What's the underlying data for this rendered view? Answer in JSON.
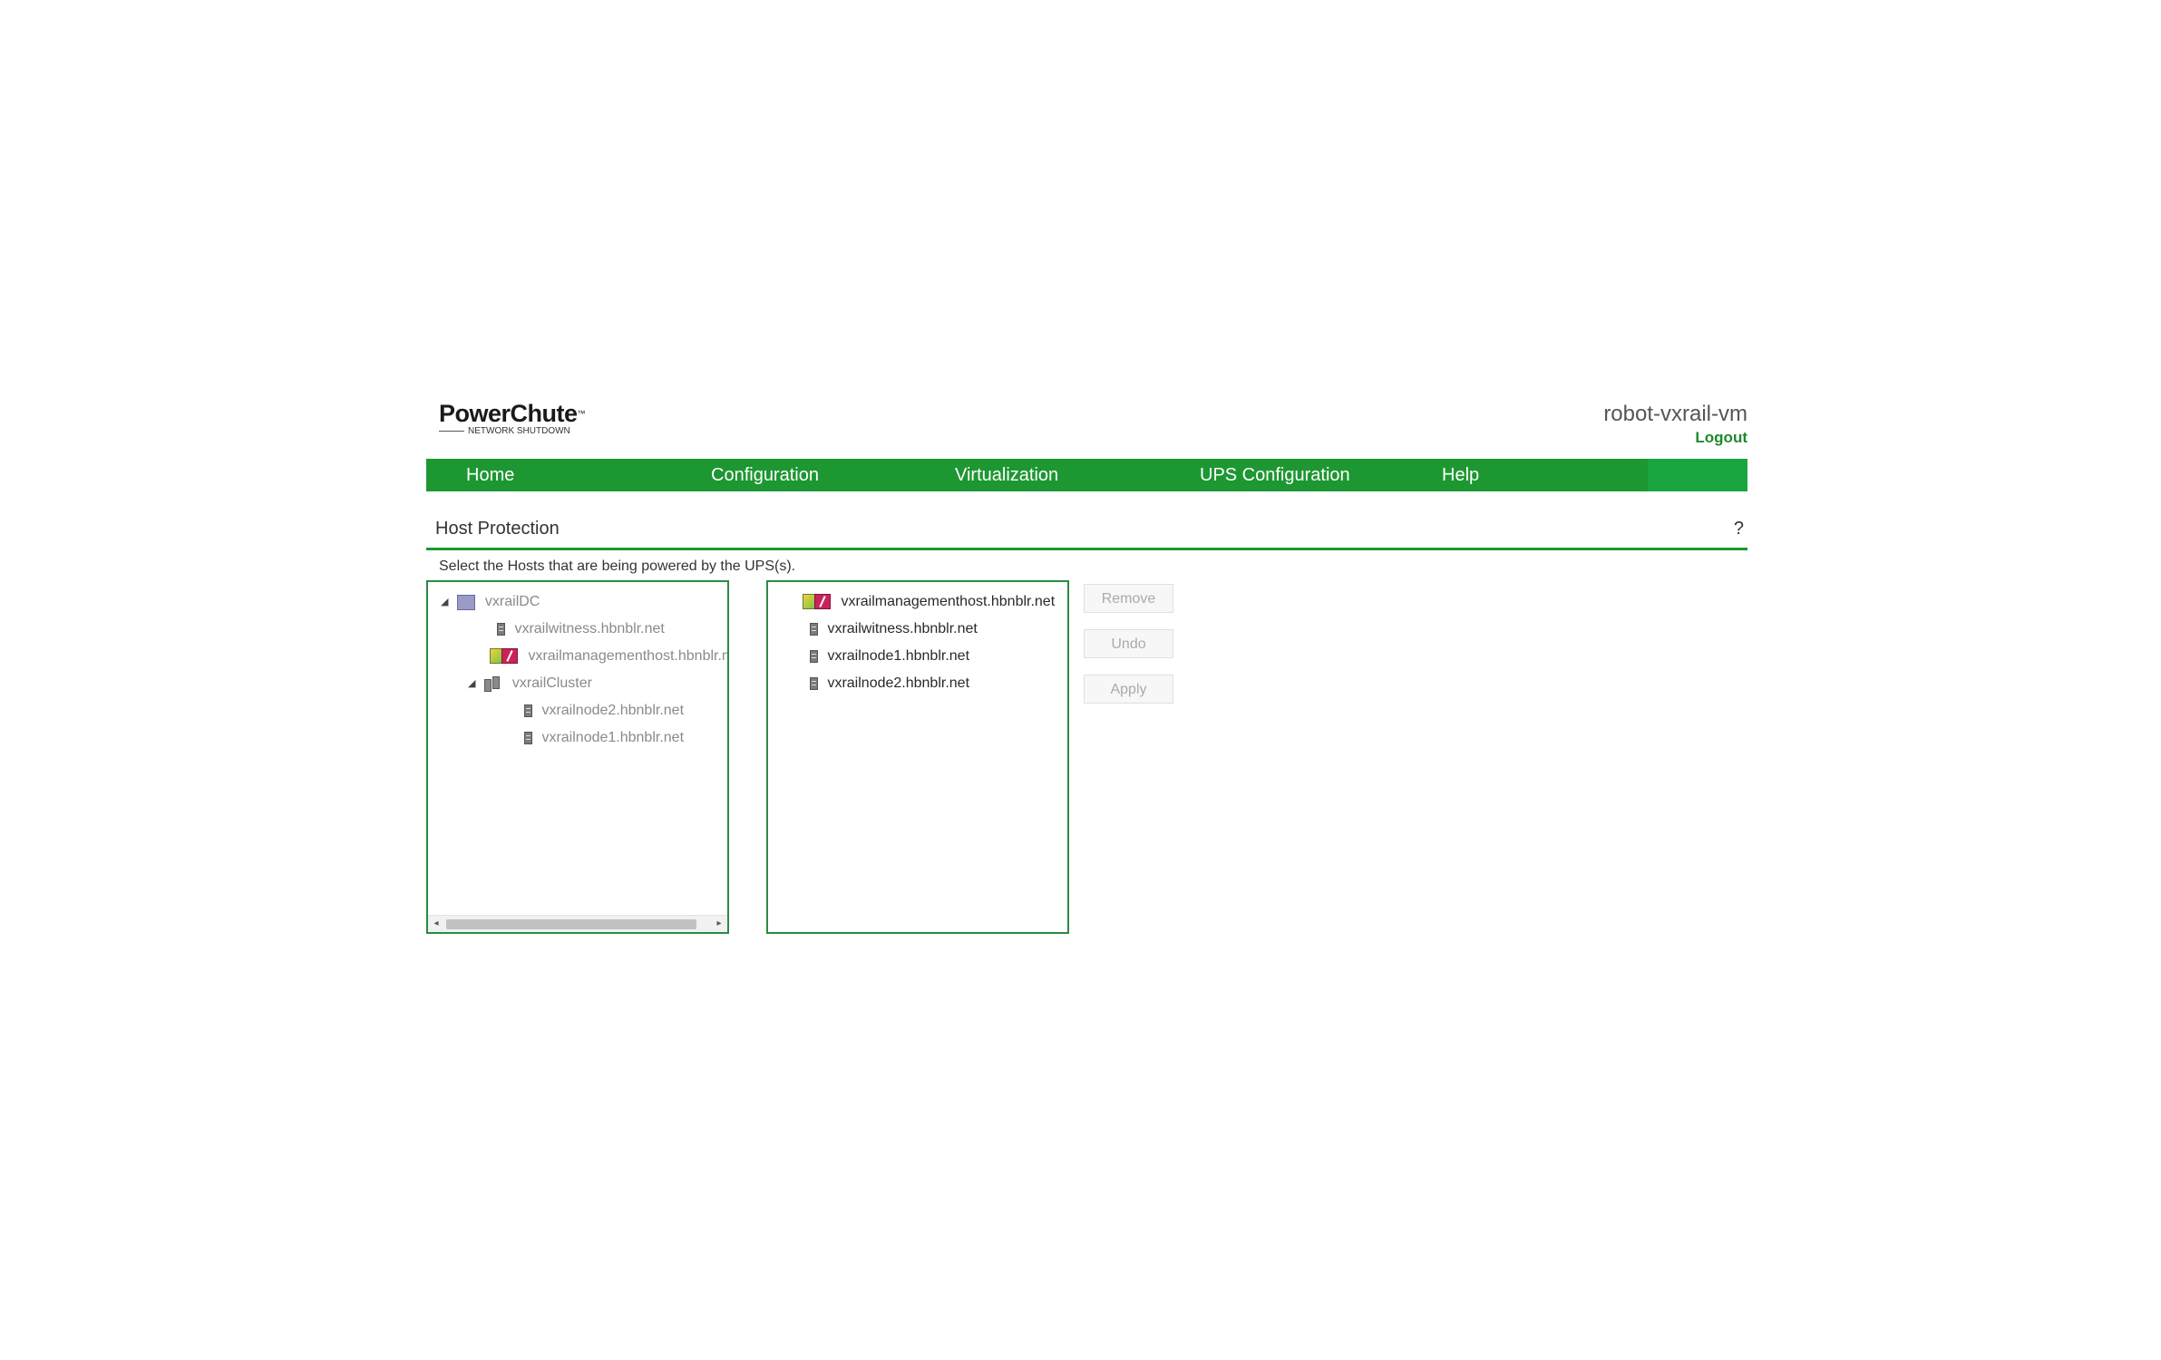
{
  "brand": {
    "logo_main": "PowerChute",
    "logo_tm": "™",
    "logo_sub": "NETWORK SHUTDOWN"
  },
  "header": {
    "hostname": "robot-vxrail-vm",
    "logout": "Logout"
  },
  "nav": {
    "items": [
      "Home",
      "Configuration",
      "Virtualization",
      "UPS Configuration",
      "Help"
    ]
  },
  "page": {
    "title": "Host Protection",
    "help": "?",
    "instruction": "Select the Hosts that are being powered by the UPS(s)."
  },
  "available_hosts": {
    "datacenter": "vxrailDC",
    "witness": "vxrailwitness.hbnblr.net",
    "management_host": "vxrailmanagementhost.hbnblr.net",
    "cluster": "vxrailCluster",
    "node2": "vxrailnode2.hbnblr.net",
    "node1": "vxrailnode1.hbnblr.net",
    "expander": "◢"
  },
  "selected_hosts": {
    "items": [
      "vxrailmanagementhost.hbnblr.net",
      "vxrailwitness.hbnblr.net",
      "vxrailnode1.hbnblr.net",
      "vxrailnode2.hbnblr.net"
    ]
  },
  "actions": {
    "remove": "Remove",
    "undo": "Undo",
    "apply": "Apply"
  },
  "scrollbar": {
    "left_arrow": "◂",
    "right_arrow": "▸"
  },
  "icons": [
    "datacenter-icon",
    "server-icon",
    "vm-host-icon",
    "cluster-icon"
  ],
  "colors": {
    "nav_green": "#1d9731",
    "link_green": "#1e8a2c",
    "panel_border": "#2b8a45"
  }
}
